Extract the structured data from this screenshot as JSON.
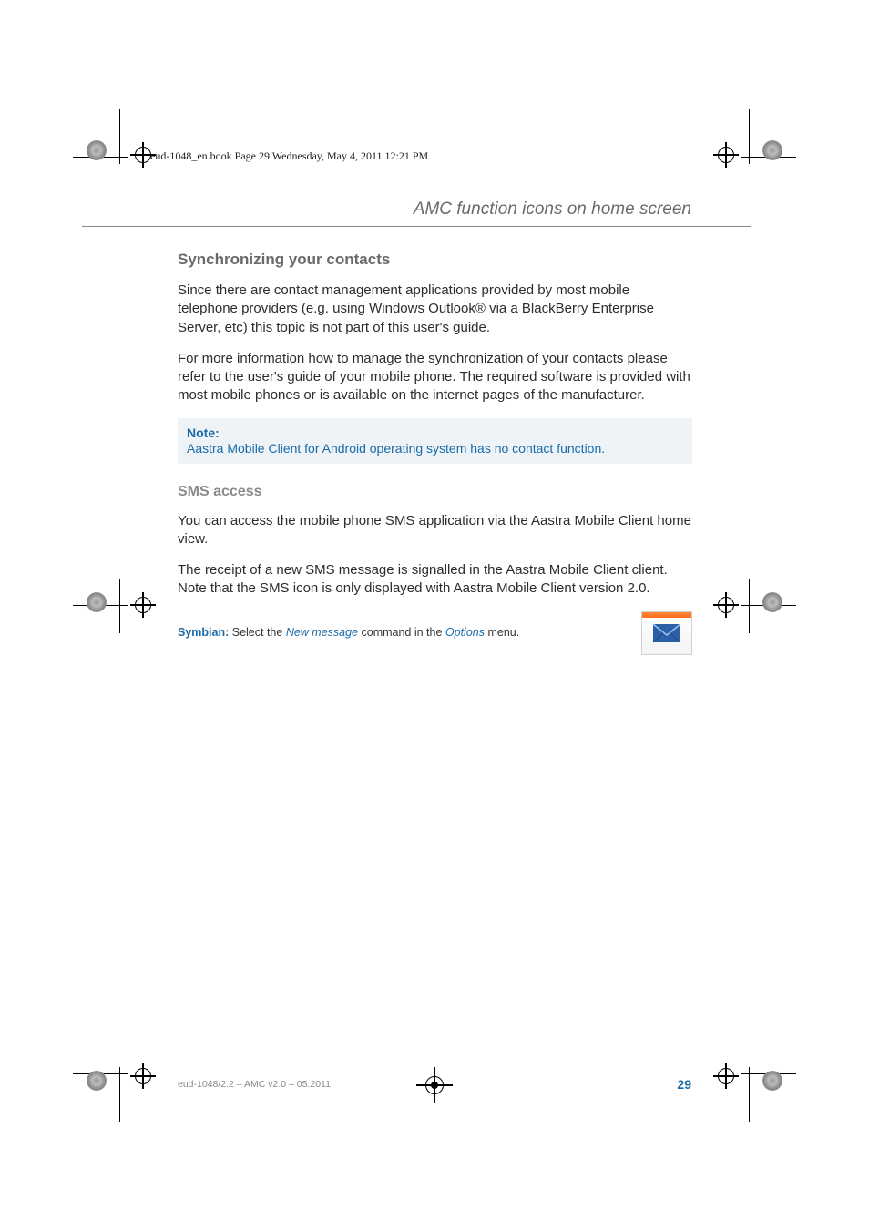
{
  "header_stamp": "eud-1048_en.book  Page 29  Wednesday, May 4, 2011  12:21 PM",
  "running_head": "AMC function icons on home screen",
  "section1": {
    "title": "Synchronizing your contacts",
    "p1": "Since there are contact management applications provided by most mobile telephone providers (e.g. using Windows Outlook® via a BlackBerry Enterprise Server, etc) this topic is not part of this user's guide.",
    "p2": "For more information how to manage the synchronization of your contacts please refer to the user's guide of your mobile phone. The required software is provided with most mobile phones or is available on the internet pages of the manufacturer."
  },
  "note": {
    "title": "Note:",
    "body": "Aastra Mobile Client for Android operating system has no contact function."
  },
  "section2": {
    "title": "SMS access",
    "p1": "You can access the mobile phone SMS application via the Aastra Mobile Client home view.",
    "p2": "The receipt of a new SMS message is signalled in the Aastra Mobile Client client. Note that the SMS icon is only displayed with Aastra Mobile Client version 2.0."
  },
  "instruction": {
    "brand": "Symbian:",
    "pre": " Select the ",
    "cmd": "New message",
    "mid": " command in the ",
    "menu": "Options",
    "post": " menu."
  },
  "footer": {
    "left": "eud-1048/2.2 – AMC v2.0 – 05.2011",
    "page": "29"
  }
}
